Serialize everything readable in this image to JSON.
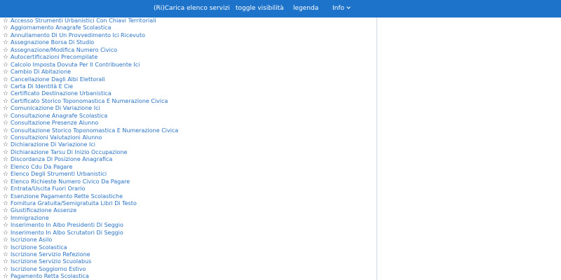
{
  "nav": {
    "reload_label": "(Ri)Carica elenco servizi",
    "toggle_label": "toggle visibilità",
    "legend_label": "legenda",
    "info_label": "Info"
  },
  "services": [
    "Accesso Strumenti Urbanistici Con Chiavi Territoriali",
    "Aggiornamento Anagrafe Scolastica",
    "Annullamento Di Un Provvedimento Ici Ricevuto",
    "Assegnazione Borsa Di Studio",
    "Assegnazione/Modifica Numero Civico",
    "Autocertificazioni Precompilate",
    "Calcolo Imposta Dovuta Per Il Contribuente Ici",
    "Cambio Di Abitazione",
    "Cancellazione Dagli Albi Elettorali",
    "Carta Di Identità E Cie",
    "Certificato Destinazione Urbanistica",
    "Certificato Storico Toponomastica E Numerazione Civica",
    "Comunicazione Di Variazione Ici",
    "Consultazione Anagrafe Scolastica",
    "Consultazione Presenze Alunno",
    "Consultazione Storico Toponomastica E Numerazione Civica",
    "Consultazioni Valutazioni Alunno",
    "Dichiarazione Di Variazione Ici",
    "Dichiarazione Tarsu Di Inizio Occupazione",
    "Discordanza Di Posizione Anagrafica",
    "Elenco Cdu Da Pagare",
    "Elenco Degli Strumenti Urbanistici",
    "Elenco Richieste Numero Civico Da Pagare",
    "Entrata/Uscita Fuori Orario",
    "Esenzione Pagamento Rette Scolastiche",
    "Fornitura Gratuita/Semigratuita Libri Di Testo",
    "Giustificazione Assenze",
    "Immigrazione",
    "Inserimento In Albo Presidenti Di Seggio",
    "Inserimento In Albo Scrutatori Di Seggio",
    "Iscrizione Asilo",
    "Iscrizione Scolastica",
    "Iscrizione Servizio Refezione",
    "Iscrizione Servizio Scuolabus",
    "Iscrizione Soggiorno Estivo",
    "Pagamento Retta Scolastica"
  ]
}
